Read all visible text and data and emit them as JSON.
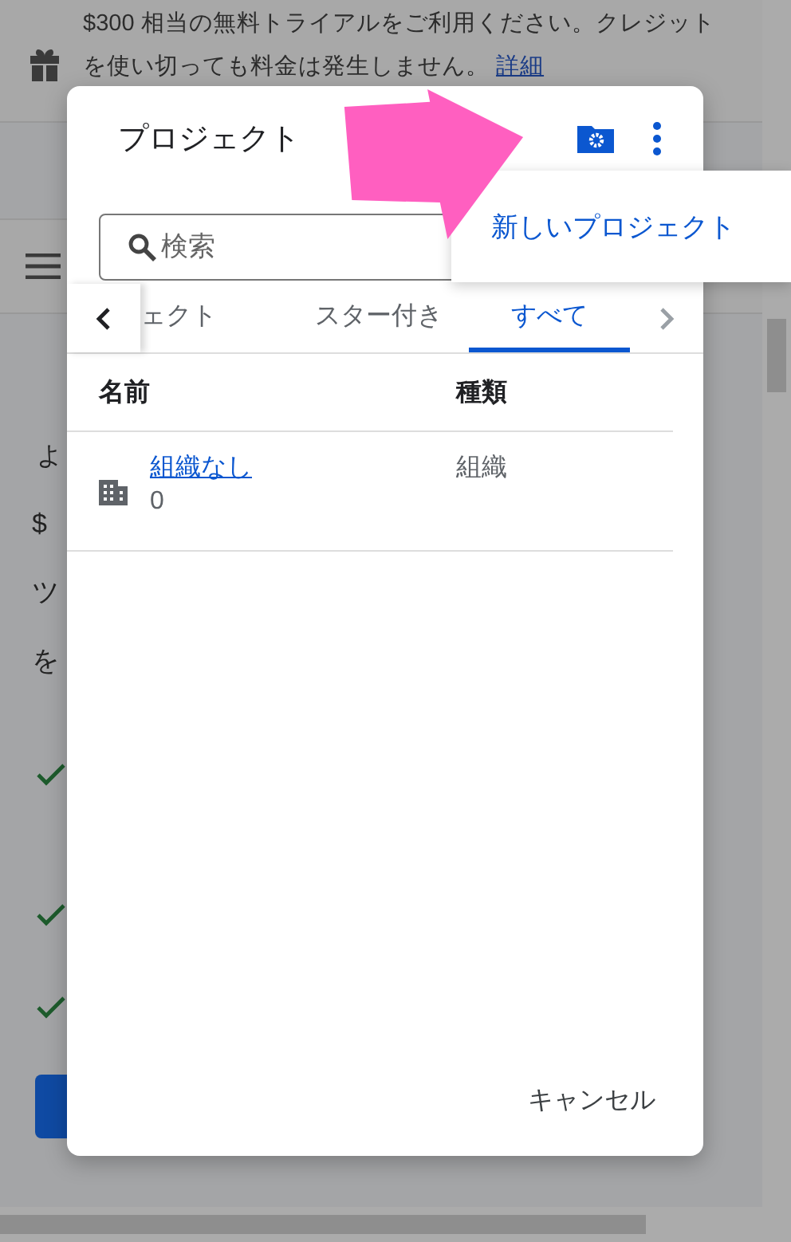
{
  "banner": {
    "text": "$300 相当の無料トライアルをご利用ください。クレジットを使い切っても料金は発生しません。",
    "link": "詳細"
  },
  "background": {
    "fragments": [
      "よ",
      "$",
      "ツ",
      "を"
    ]
  },
  "dialog": {
    "title": "プロジェクト",
    "search": {
      "placeholder": "検索"
    },
    "tabs": [
      {
        "label": "ェクト",
        "selected": false
      },
      {
        "label": "スター付き",
        "selected": false
      },
      {
        "label": "すべて",
        "selected": true
      }
    ],
    "columns": [
      "名前",
      "種類"
    ],
    "rows": [
      {
        "name": "組織なし",
        "count": "0",
        "type": "組織"
      }
    ],
    "cancel": "キャンセル"
  },
  "menu": {
    "items": [
      "新しいプロジェクト"
    ]
  }
}
